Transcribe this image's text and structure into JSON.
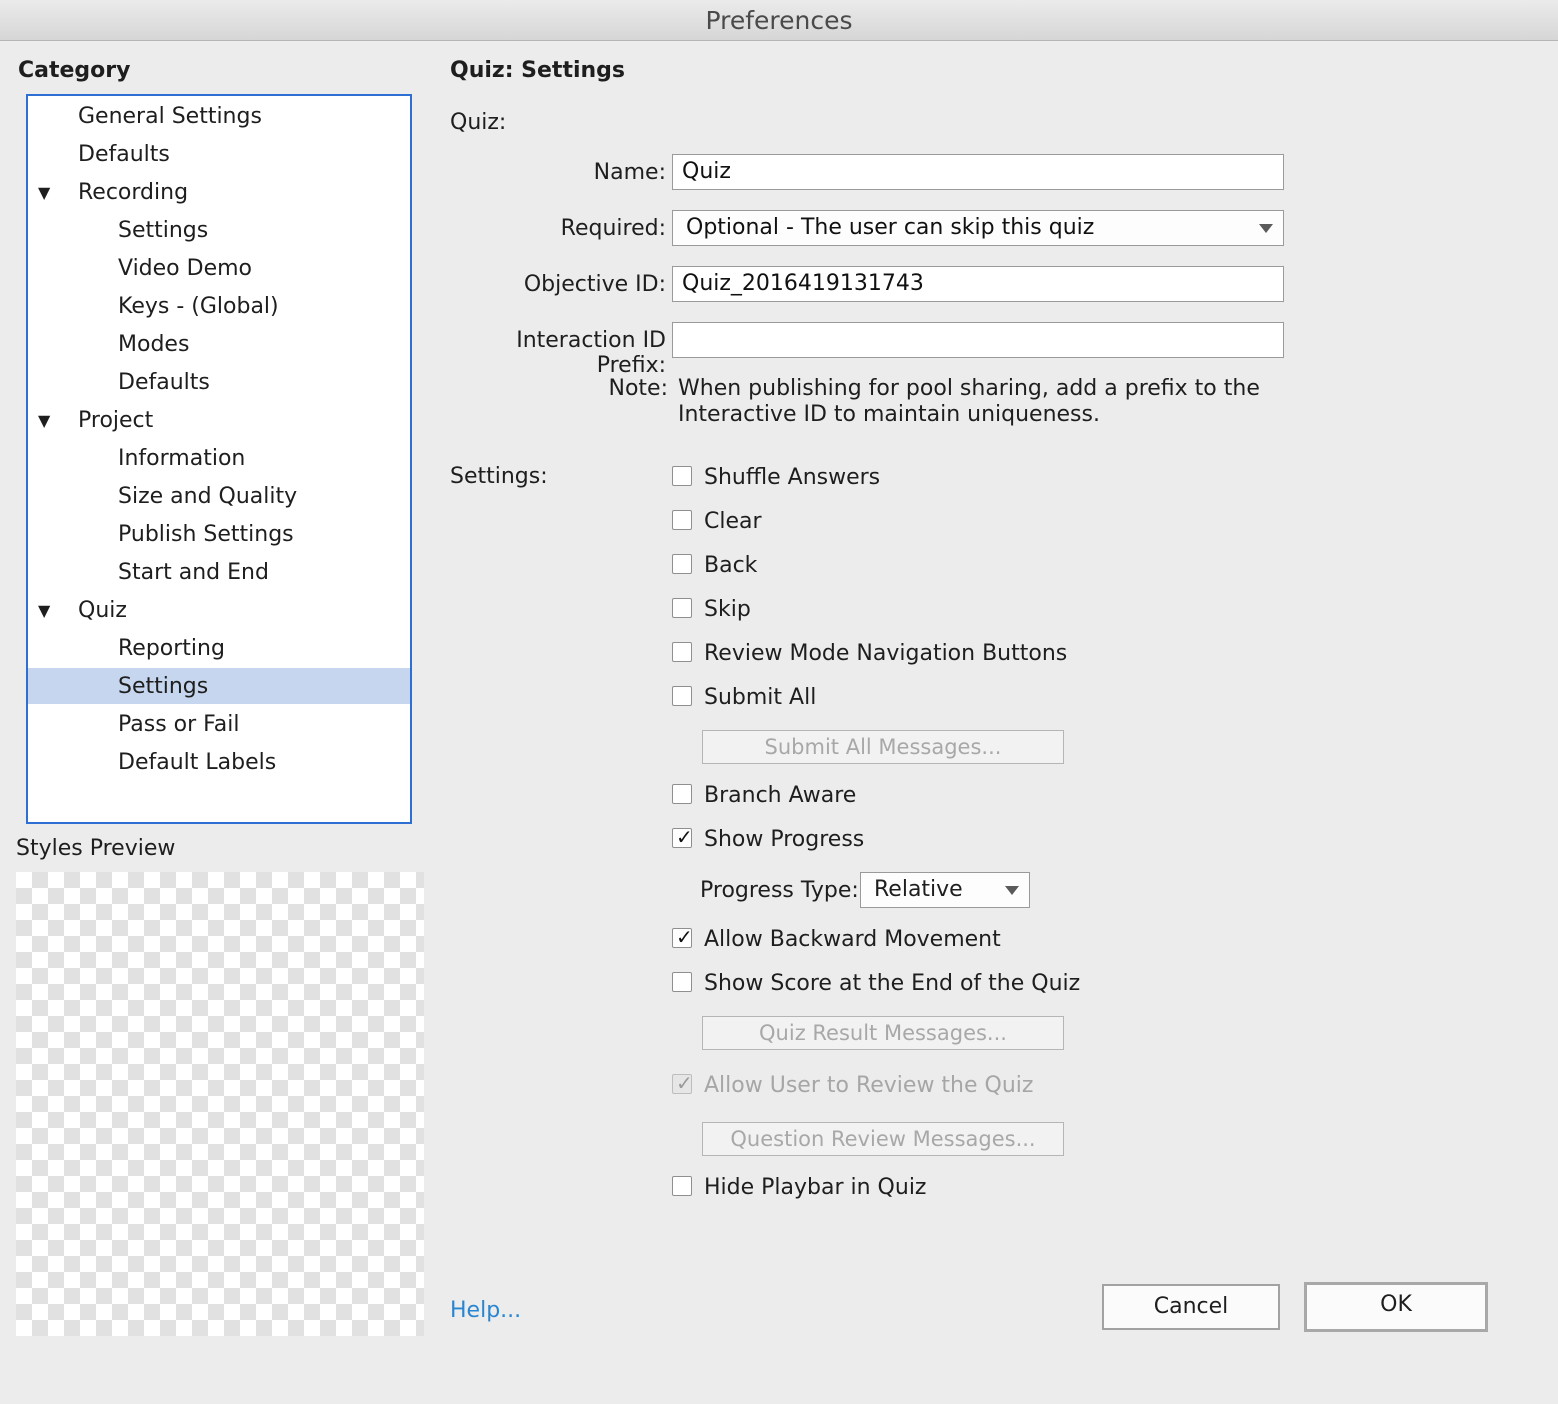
{
  "window": {
    "title": "Preferences"
  },
  "sidebar": {
    "heading": "Category",
    "items": [
      {
        "label": "General Settings",
        "level": 0,
        "expandable": false,
        "selected": false
      },
      {
        "label": "Defaults",
        "level": 0,
        "expandable": false,
        "selected": false
      },
      {
        "label": "Recording",
        "level": 0,
        "expandable": true,
        "selected": false
      },
      {
        "label": "Settings",
        "level": 1,
        "expandable": false,
        "selected": false
      },
      {
        "label": "Video Demo",
        "level": 1,
        "expandable": false,
        "selected": false
      },
      {
        "label": "Keys - (Global)",
        "level": 1,
        "expandable": false,
        "selected": false
      },
      {
        "label": "Modes",
        "level": 1,
        "expandable": false,
        "selected": false
      },
      {
        "label": "Defaults",
        "level": 1,
        "expandable": false,
        "selected": false
      },
      {
        "label": "Project",
        "level": 0,
        "expandable": true,
        "selected": false
      },
      {
        "label": "Information",
        "level": 1,
        "expandable": false,
        "selected": false
      },
      {
        "label": "Size and Quality",
        "level": 1,
        "expandable": false,
        "selected": false
      },
      {
        "label": "Publish Settings",
        "level": 1,
        "expandable": false,
        "selected": false
      },
      {
        "label": "Start and End",
        "level": 1,
        "expandable": false,
        "selected": false
      },
      {
        "label": "Quiz",
        "level": 0,
        "expandable": true,
        "selected": false
      },
      {
        "label": "Reporting",
        "level": 1,
        "expandable": false,
        "selected": false
      },
      {
        "label": "Settings",
        "level": 1,
        "expandable": false,
        "selected": true
      },
      {
        "label": "Pass or Fail",
        "level": 1,
        "expandable": false,
        "selected": false
      },
      {
        "label": "Default Labels",
        "level": 1,
        "expandable": false,
        "selected": false
      }
    ],
    "styles_preview_label": "Styles Preview"
  },
  "main": {
    "title": "Quiz: Settings",
    "quiz_section": "Quiz:",
    "fields": {
      "name_label": "Name:",
      "name_value": "Quiz",
      "required_label": "Required:",
      "required_value": "Optional - The user can skip this quiz",
      "objective_label": "Objective ID:",
      "objective_value": "Quiz_2016419131743",
      "interaction_label": "Interaction ID Prefix:",
      "interaction_value": ""
    },
    "note_label": "Note:",
    "note_text": "When publishing for pool sharing, add a prefix to the Interactive ID to maintain uniqueness.",
    "settings_label": "Settings:",
    "checkboxes": {
      "shuffle": {
        "label": "Shuffle Answers",
        "checked": false
      },
      "clear": {
        "label": "Clear",
        "checked": false
      },
      "back": {
        "label": "Back",
        "checked": false
      },
      "skip": {
        "label": "Skip",
        "checked": false
      },
      "review_nav": {
        "label": "Review Mode Navigation Buttons",
        "checked": false
      },
      "submit_all": {
        "label": "Submit All",
        "checked": false
      },
      "branch_aware": {
        "label": "Branch Aware",
        "checked": false
      },
      "show_progress": {
        "label": "Show Progress",
        "checked": true
      },
      "allow_backward": {
        "label": "Allow Backward Movement",
        "checked": true
      },
      "show_score": {
        "label": "Show Score at the End of the Quiz",
        "checked": false
      },
      "allow_review": {
        "label": "Allow User to Review the Quiz",
        "checked": true,
        "disabled": true
      },
      "hide_playbar": {
        "label": "Hide Playbar in Quiz",
        "checked": false
      }
    },
    "buttons": {
      "submit_all_messages": "Submit All Messages...",
      "quiz_result_messages": "Quiz Result Messages...",
      "question_review_messages": "Question Review Messages..."
    },
    "progress_type_label": "Progress Type:",
    "progress_type_value": "Relative"
  },
  "footer": {
    "help": "Help...",
    "cancel": "Cancel",
    "ok": "OK"
  },
  "icons": {
    "check_mark": "✓",
    "expand_arrow": "▼"
  }
}
